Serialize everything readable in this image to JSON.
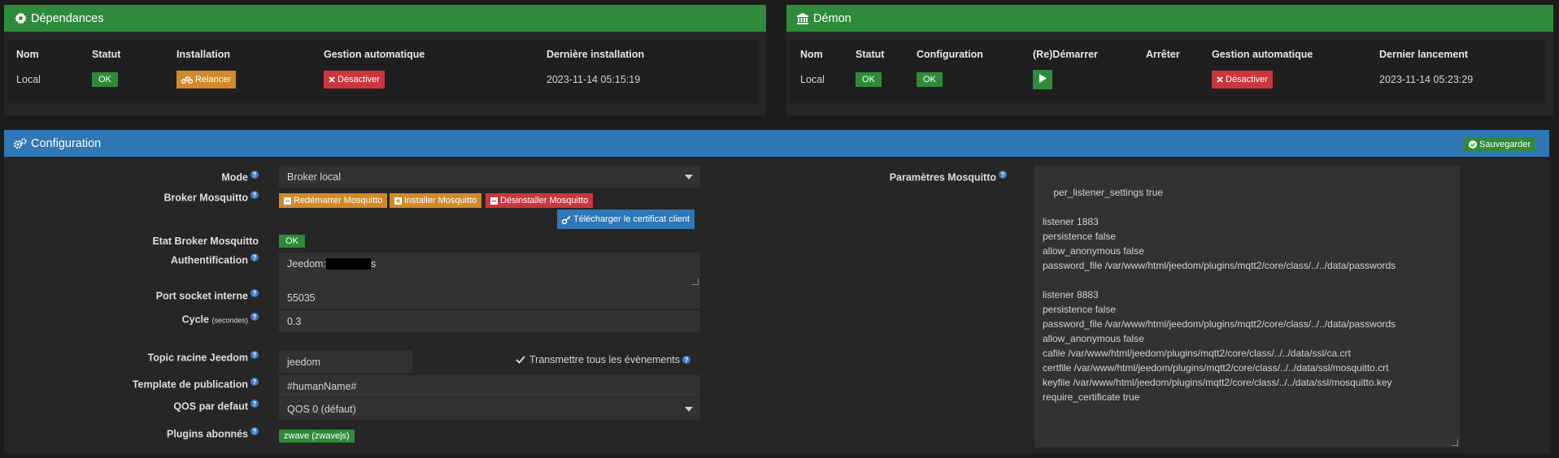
{
  "dependances": {
    "title": "Dépendances",
    "headers": [
      "Nom",
      "Statut",
      "Installation",
      "Gestion automatique",
      "Dernière installation"
    ],
    "row": {
      "nom": "Local",
      "statut": "OK",
      "installation": "Relancer",
      "gestion": "Désactiver",
      "derniere": "2023-11-14 05:15:19"
    }
  },
  "demon": {
    "title": "Démon",
    "headers": [
      "Nom",
      "Statut",
      "Configuration",
      "(Re)Démarrer",
      "Arrêter",
      "Gestion automatique",
      "Dernier lancement"
    ],
    "row": {
      "nom": "Local",
      "statut": "OK",
      "configuration": "OK",
      "gestion": "Désactiver",
      "dernier": "2023-11-14 05:23:29"
    }
  },
  "config": {
    "title": "Configuration",
    "save_label": "Sauvegarder",
    "mode_label": "Mode",
    "mode_value": "Broker local",
    "broker_label": "Broker Mosquitto",
    "btn_restart": "Redémarrer Mosquitto",
    "btn_install": "Installer Mosquitto",
    "btn_uninstall": "Désinstaller Mosquitto",
    "btn_cert": "Télécharger le certificat client",
    "etat_label": "Etat Broker Mosquitto",
    "etat_value": "OK",
    "auth_label": "Authentification",
    "auth_prefix": "Jeedom:",
    "auth_suffix": "s",
    "port_label": "Port socket interne",
    "port_value": "55035",
    "cycle_label": "Cycle",
    "cycle_unit": "(secondes)",
    "cycle_value": "0.3",
    "topic_label": "Topic racine Jeedom",
    "topic_value": "jeedom",
    "transmit_label": "Transmettre tous les évènements",
    "template_label": "Template de publication",
    "template_value": "#humanName#",
    "qos_label": "QOS par defaut",
    "qos_value": "QOS 0 (défaut)",
    "plugins_label": "Plugins abonnés",
    "plugins_value": "zwave (zwavejs)",
    "params_label": "Paramètres Mosquitto",
    "params_value": "per_listener_settings true\n\nlistener 1883\npersistence false\nallow_anonymous false\npassword_file /var/www/html/jeedom/plugins/mqtt2/core/class/../../data/passwords\n\nlistener 8883\npersistence false\npassword_file /var/www/html/jeedom/plugins/mqtt2/core/class/../../data/passwords\nallow_anonymous false\ncafile /var/www/html/jeedom/plugins/mqtt2/core/class/../../data/ssl/ca.crt\ncertfile /var/www/html/jeedom/plugins/mqtt2/core/class/../../data/ssl/mosquitto.crt\nkeyfile /var/www/html/jeedom/plugins/mqtt2/core/class/../../data/ssl/mosquitto.key\nrequire_certificate true"
  },
  "icons": {
    "dependances": "gear-icon",
    "demon": "bank-icon",
    "config": "gears-icon",
    "relancer": "bicycle-icon",
    "desactiver": "times-icon",
    "play": "play-icon",
    "save": "check-circle-icon",
    "cert": "key-icon",
    "help": "question-circle-icon"
  },
  "colors": {
    "green": "#2e8b3a",
    "blue": "#2f77b5",
    "orange": "#d08a2a",
    "red": "#c9363d"
  }
}
